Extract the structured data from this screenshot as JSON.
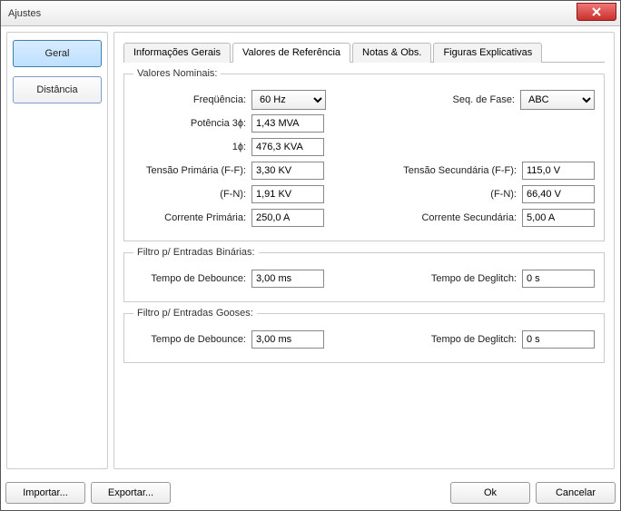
{
  "window": {
    "title": "Ajustes"
  },
  "sidebar": {
    "general": "Geral",
    "distance": "Distância"
  },
  "tabs": {
    "info": "Informações Gerais",
    "ref": "Valores de Referência",
    "notes": "Notas & Obs.",
    "figs": "Figuras Explicativas"
  },
  "nominal": {
    "legend": "Valores Nominais:",
    "freq_label": "Freqüência:",
    "freq_value": "60 Hz",
    "seq_label": "Seq. de Fase:",
    "seq_value": "ABC",
    "p3_label": "Potência 3ɸ:",
    "p3_value": "1,43 MVA",
    "p1_label": "1ɸ:",
    "p1_value": "476,3 KVA",
    "vprim_ff_label": "Tensão Primária (F-F):",
    "vprim_ff_value": "3,30 KV",
    "vsec_ff_label": "Tensão Secundária (F-F):",
    "vsec_ff_value": "115,0 V",
    "fn_label": "(F-N):",
    "vprim_fn_value": "1,91 KV",
    "vsec_fn_value": "66,40 V",
    "iprim_label": "Corrente Primária:",
    "iprim_value": "250,0 A",
    "isec_label": "Corrente Secundária:",
    "isec_value": "5,00 A"
  },
  "bin": {
    "legend": "Filtro p/ Entradas Binárias:",
    "debounce_label": "Tempo de Debounce:",
    "debounce_value": "3,00 ms",
    "deglitch_label": "Tempo de Deglitch:",
    "deglitch_value": "0 s"
  },
  "goose": {
    "legend": "Filtro p/ Entradas Gooses:",
    "debounce_label": "Tempo de Debounce:",
    "debounce_value": "3,00 ms",
    "deglitch_label": "Tempo de Deglitch:",
    "deglitch_value": "0 s"
  },
  "buttons": {
    "import": "Importar...",
    "export": "Exportar...",
    "ok": "Ok",
    "cancel": "Cancelar"
  }
}
